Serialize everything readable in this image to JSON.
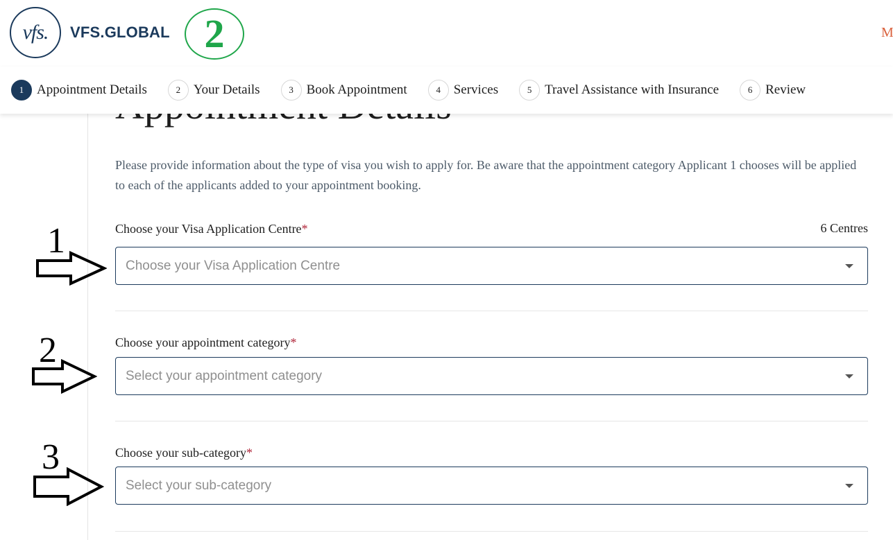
{
  "header": {
    "logo_mark": "vfs.",
    "logo_text": "VFS.GLOBAL",
    "badge_number": "2",
    "right_text": "M"
  },
  "stepper": {
    "steps": [
      {
        "number": "1",
        "label": "Appointment Details",
        "active": true
      },
      {
        "number": "2",
        "label": "Your Details",
        "active": false
      },
      {
        "number": "3",
        "label": "Book Appointment",
        "active": false
      },
      {
        "number": "4",
        "label": "Services",
        "active": false
      },
      {
        "number": "5",
        "label": "Travel Assistance with Insurance",
        "active": false
      },
      {
        "number": "6",
        "label": "Review",
        "active": false
      }
    ]
  },
  "main": {
    "title": "Appointment Details",
    "intro": "Please provide information about the type of visa you wish to apply for. Be aware that the appointment category Applicant 1 chooses will be applied to each of the applicants added to your appointment booking.",
    "fields": [
      {
        "label": "Choose your Visa Application Centre",
        "required_mark": "*",
        "placeholder": "Choose your Visa Application Centre",
        "count": "6 Centres"
      },
      {
        "label": "Choose your appointment category",
        "required_mark": "*",
        "placeholder": "Select your appointment category"
      },
      {
        "label": "Choose your sub-category",
        "required_mark": "*",
        "placeholder": "Select your sub-category"
      }
    ]
  },
  "annotations": [
    "1",
    "2",
    "3"
  ],
  "colors": {
    "brand_navy": "#1b3a5c",
    "badge_green": "#1fa64a",
    "required_red": "#b0263a",
    "accent_orange": "#d9603b"
  }
}
